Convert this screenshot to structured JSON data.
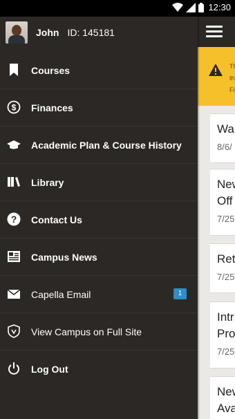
{
  "status_bar": {
    "time": "12:30"
  },
  "profile": {
    "name": "John",
    "id_text": "ID: 145181"
  },
  "menu": [
    {
      "label": "Courses",
      "icon": "bookmark-icon"
    },
    {
      "label": "Finances",
      "icon": "dollar-icon"
    },
    {
      "label": "Academic Plan & Course History",
      "icon": "graduation-cap-icon"
    },
    {
      "label": "Library",
      "icon": "library-icon"
    },
    {
      "label": "Contact Us",
      "icon": "help-icon"
    },
    {
      "label": "Campus News",
      "icon": "news-icon"
    },
    {
      "label": "Capella Email",
      "icon": "mail-icon",
      "badge": "1"
    },
    {
      "label": "View Campus on Full Site",
      "icon": "shield-icon"
    },
    {
      "label": "Log Out",
      "icon": "power-icon"
    }
  ],
  "background": {
    "alert_lines": [
      "Th",
      "th",
      "Fi"
    ],
    "cards": [
      {
        "title": "Wa",
        "date": "8/6/"
      },
      {
        "title": "New Off",
        "date": "7/25"
      },
      {
        "title": "Ret",
        "date": "7/25"
      },
      {
        "title": "Intr Pro",
        "date": "7/25"
      },
      {
        "title": "New Ava",
        "date": ""
      }
    ]
  },
  "colors": {
    "drawer": "#2b2825",
    "badge": "#2f8dc7",
    "alert": "#f6c02b"
  }
}
